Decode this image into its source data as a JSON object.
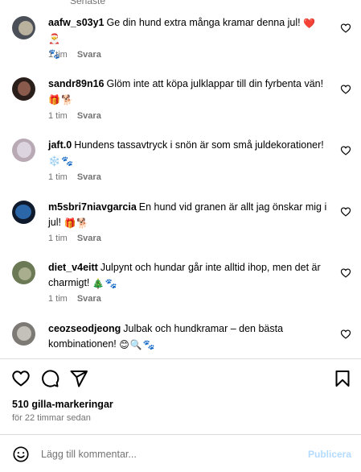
{
  "sort_label": "Senaste",
  "comments": [
    {
      "username": "aafw_s03y1",
      "text": "Ge din hund extra många kramar denna jul!",
      "emojis": [
        {
          "char": "❤️",
          "name": "red-heart-emoji"
        },
        {
          "char": "🎅",
          "name": "santa-emoji"
        },
        {
          "char": "🐾",
          "name": "paw-prints-emoji"
        }
      ],
      "time": "1 tim",
      "reply": "Svara",
      "avatar_colors": [
        "#4a4f58",
        "#b9b19e"
      ]
    },
    {
      "username": "sandr89n16",
      "text": "Glöm inte att köpa julklappar till din fyrbenta vän!",
      "emojis": [
        {
          "char": "🎁",
          "name": "gift-emoji"
        },
        {
          "char": "🐕",
          "name": "dog-emoji"
        }
      ],
      "time": "1 tim",
      "reply": "Svara",
      "avatar_colors": [
        "#2a1e1a",
        "#8a5b4c"
      ]
    },
    {
      "username": "jaft.0",
      "text": "Hundens tassavtryck i snön är som små juldekorationer!",
      "emojis": [
        {
          "char": "❄️",
          "name": "snowflake-emoji"
        },
        {
          "char": "🐾",
          "name": "paw-prints-emoji"
        }
      ],
      "time": "1 tim",
      "reply": "Svara",
      "avatar_colors": [
        "#b8a9b4",
        "#dcd4de"
      ]
    },
    {
      "username": "m5sbri7niavgarcia",
      "text": "En hund vid granen är allt jag önskar mig i jul!",
      "emojis": [
        {
          "char": "🎁",
          "name": "gift-emoji"
        },
        {
          "char": "🐕",
          "name": "dog-emoji"
        }
      ],
      "time": "1 tim",
      "reply": "Svara",
      "avatar_colors": [
        "#2a66a8",
        "#0f1a2c"
      ]
    },
    {
      "username": "diet_v4eitt",
      "text": "Julpynt och hundar går inte alltid ihop, men det är charmigt!",
      "emojis": [
        {
          "char": "🎄",
          "name": "christmas-tree-emoji"
        },
        {
          "char": "🐾",
          "name": "paw-prints-emoji"
        }
      ],
      "time": "1 tim",
      "reply": "Svara",
      "avatar_colors": [
        "#6b7a55",
        "#a9ae8e"
      ]
    },
    {
      "username": "ceozseodjeong",
      "text": "Julbak och hundkramar – den bästa kombinationen!",
      "emojis": [
        {
          "char": "😊",
          "name": "smiling-face-emoji"
        },
        {
          "char": "🔍",
          "name": "magnifier-emoji"
        },
        {
          "char": "🐾",
          "name": "paw-prints-emoji"
        }
      ],
      "time": "",
      "reply": "",
      "avatar_colors": [
        "#7d7a76",
        "#c4c0ba"
      ]
    }
  ],
  "likes_label": "510 gilla-markeringar",
  "timestamp": "för 22 timmar sedan",
  "add_comment": {
    "placeholder": "Lägg till kommentar...",
    "publish_label": "Publicera"
  },
  "icons": {
    "like": "heart-outline-icon",
    "comment": "speech-bubble-icon",
    "share": "paper-plane-icon",
    "save": "bookmark-icon",
    "emoji": "smiley-icon"
  },
  "colors": {
    "muted_text": "#737373",
    "publish_disabled": "#b3dbff",
    "divider": "#dbdbdb"
  }
}
